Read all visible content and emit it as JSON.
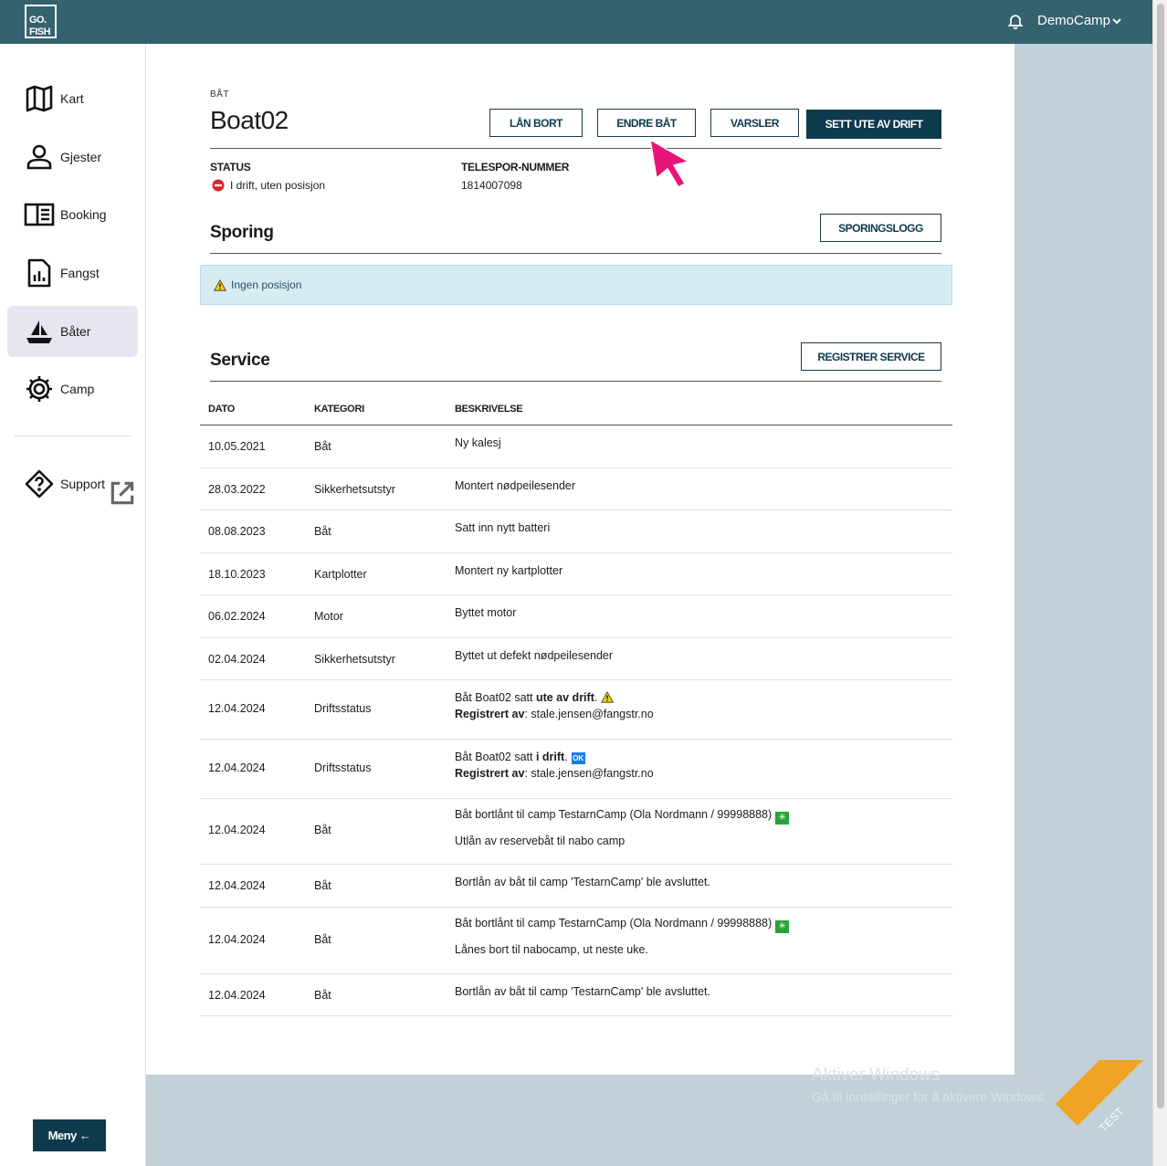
{
  "header": {
    "logo_line1": "GO.",
    "logo_line2": "FISH",
    "user": "DemoCamp"
  },
  "sidebar": {
    "items": [
      {
        "label": "Kart",
        "icon": "map-icon"
      },
      {
        "label": "Gjester",
        "icon": "person-icon"
      },
      {
        "label": "Booking",
        "icon": "book-icon"
      },
      {
        "label": "Fangst",
        "icon": "chart-file-icon"
      },
      {
        "label": "Båter",
        "icon": "sailboat-icon",
        "active": true
      },
      {
        "label": "Camp",
        "icon": "gear-icon"
      }
    ],
    "support": "Support",
    "menu_button": "Meny ←"
  },
  "boat": {
    "eyebrow": "BÅT",
    "name": "Boat02",
    "buttons": {
      "lend": "LÅN BORT",
      "edit": "ENDRE BÅT",
      "alerts": "VARSLER",
      "out_of_service": "SETT UTE AV DRIFT"
    },
    "status_label": "STATUS",
    "status_value": "I drift, uten posisjon",
    "tracker_label": "TELESPOR-NUMMER",
    "tracker_value": "1814007098"
  },
  "tracking": {
    "title": "Sporing",
    "log_button": "SPORINGSLOGG",
    "alert_text": "Ingen posisjon"
  },
  "service": {
    "title": "Service",
    "register_button": "REGISTRER SERVICE",
    "columns": [
      "DATO",
      "KATEGORI",
      "BESKRIVELSE"
    ],
    "rows": [
      {
        "date": "10.05.2021",
        "category": "Båt",
        "desc": "Ny kalesj"
      },
      {
        "date": "28.03.2022",
        "category": "Sikkerhetsutstyr",
        "desc": "Montert nødpeilesender"
      },
      {
        "date": "08.08.2023",
        "category": "Båt",
        "desc": "Satt inn nytt batteri"
      },
      {
        "date": "18.10.2023",
        "category": "Kartplotter",
        "desc": "Montert ny kartplotter"
      },
      {
        "date": "06.02.2024",
        "category": "Motor",
        "desc": "Byttet motor"
      },
      {
        "date": "02.04.2024",
        "category": "Sikkerhetsutstyr",
        "desc": "Byttet ut defekt nødpeilesender"
      },
      {
        "date": "12.04.2024",
        "category": "Driftsstatus",
        "desc_prefix": "Båt Boat02 satt ",
        "desc_bold": "ute av drift",
        "desc_suffix": ".",
        "reg_label": "Registrert av",
        "reg_value": ": stale.jensen@fangstr.no"
      },
      {
        "date": "12.04.2024",
        "category": "Driftsstatus",
        "desc_prefix": "Båt Boat02 satt ",
        "desc_bold": "i drift",
        "desc_suffix": ".",
        "badge": "OK",
        "reg_label": "Registrert av",
        "reg_value": ": stale.jensen@fangstr.no"
      },
      {
        "date": "12.04.2024",
        "category": "Båt",
        "desc": "Båt bortlånt til camp TestarnCamp (Ola Nordmann / 99998888)",
        "note": "Utlån av reservebåt til nabo camp"
      },
      {
        "date": "12.04.2024",
        "category": "Båt",
        "desc": "Bortlån av båt til camp 'TestarnCamp' ble avsluttet."
      },
      {
        "date": "12.04.2024",
        "category": "Båt",
        "desc": "Båt bortlånt til camp TestarnCamp (Ola Nordmann / 99998888)",
        "note": "Lånes bort til nabocamp, ut neste uke."
      },
      {
        "date": "12.04.2024",
        "category": "Båt",
        "desc": "Bortlån av båt til camp 'TestarnCamp' ble avsluttet."
      }
    ]
  },
  "watermark": {
    "line1": "Aktiver Windows",
    "line2": "Gå til Innstillinger for å aktivere Windows."
  },
  "corner_badge": "TEST",
  "colors": {
    "topbar": "#35626f",
    "primary_button": "#0e3a4e",
    "alert_bg": "#d7ecf2",
    "cursor": "#e8147a",
    "corner": "#f0a424"
  }
}
